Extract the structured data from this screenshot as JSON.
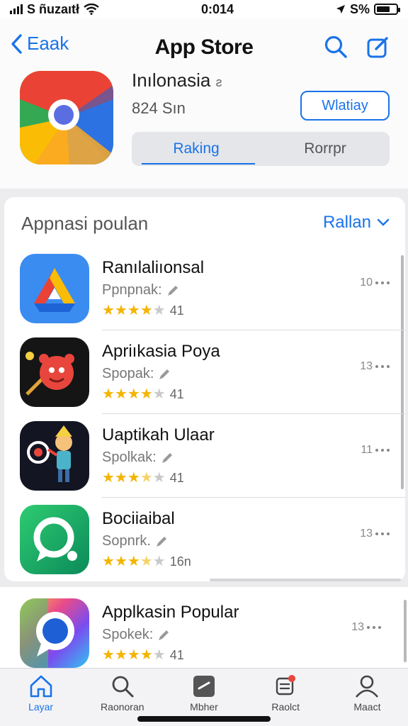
{
  "status": {
    "carrier": "S ñuzaıtł",
    "time": "0:014",
    "battery": "S%",
    "battery_level": 0.7
  },
  "nav": {
    "back_label": "Eaak",
    "title": "App Store"
  },
  "hero": {
    "name": "Inılonasia",
    "name_suffix": "ƨ",
    "size": "824 Sın",
    "action_label": "Wlatiay",
    "segments": [
      "Raking",
      "Rorrpr"
    ]
  },
  "section": {
    "title": "Appnasi poulan",
    "action_label": "Rallan"
  },
  "apps": [
    {
      "name": "Ranılaliıonsal",
      "sub": "Ppnpnak:",
      "stars": 4,
      "count": "41",
      "meta": "10"
    },
    {
      "name": "Apriıkasia Poya",
      "sub": "Spopak:",
      "stars": 4,
      "count": "41",
      "meta": "13"
    },
    {
      "name": "Uaptikah Ulaar",
      "sub": "Spolkak:",
      "stars": 3.5,
      "count": "41",
      "meta": "11"
    },
    {
      "name": "Bociiaibal",
      "sub": "Sopnrk.",
      "stars": 3.5,
      "count": "16n",
      "meta": "13"
    }
  ],
  "extra_app": {
    "name": "Applkasin Popular",
    "sub": "Spokek:",
    "stars": 4,
    "count": "41",
    "meta": "13"
  },
  "tabs": [
    "Layar",
    "Raonoran",
    "Mbher",
    "Raolct",
    "Maact"
  ],
  "colors": {
    "accent": "#1a73e8",
    "star": "#f5b400"
  }
}
